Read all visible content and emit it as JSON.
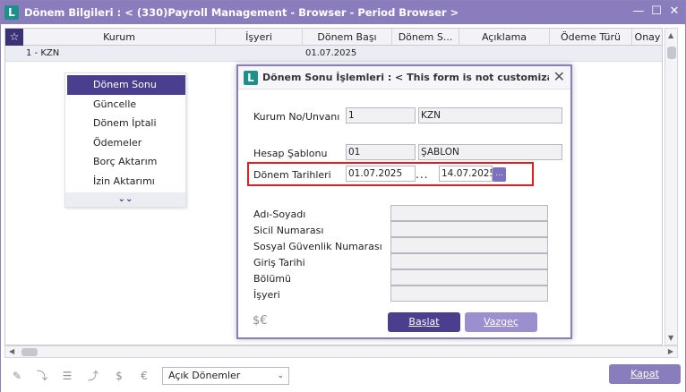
{
  "main_window": {
    "logo_letter": "L",
    "title": "Dönem Bilgileri : < (330)Payroll Management - Browser - Period Browser >",
    "controls": [
      "—",
      "☐",
      "✕"
    ]
  },
  "grid": {
    "star": "☆",
    "columns": [
      "Kurum",
      "İşyeri",
      "Dönem Başı",
      "Dönem S...",
      "Açıklama",
      "Ödeme Türü",
      "Onay"
    ],
    "rows": [
      {
        "kurum": "1 - KZN",
        "isyeri": "",
        "donem_basi": "01.07.2025"
      }
    ]
  },
  "context_menu": {
    "items": [
      "Dönem Sonu",
      "Güncelle",
      "Dönem İptali",
      "Ödemeler",
      "Borç Aktarım",
      "İzin Aktarımı"
    ],
    "more": "»"
  },
  "bottom_bar": {
    "filter_value": "Açık Dönemler",
    "close_label": "Kapat"
  },
  "dialog": {
    "logo_letter": "L",
    "title": "Dönem Sonu İşlemleri : < This form is not customizable ...",
    "fields": {
      "kurum_label": "Kurum No/Unvanı",
      "kurum_no": "1",
      "kurum_unvan": "KZN",
      "hesap_label": "Hesap Şablonu",
      "hesap_kod": "01",
      "hesap_ad": "ŞABLON",
      "tarih_label": "Dönem Tarihleri",
      "tarih_baslangic": "01.07.2025",
      "tarih_dots": "...",
      "tarih_bitis": "14.07.2025",
      "picker": "..."
    },
    "person_labels": [
      "Adı-Soyadı",
      "Sicil Numarası",
      "Sosyal Güvenlik Numarası",
      "Giriş Tarihi",
      "Bölümü",
      "İşyeri"
    ],
    "start_label": "Başlat",
    "cancel_label": "Vazgeç"
  }
}
